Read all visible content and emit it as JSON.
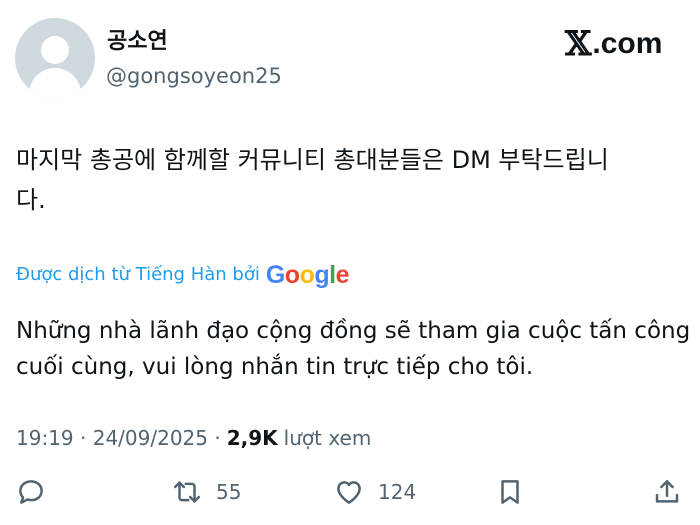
{
  "author": {
    "display_name": "공소연",
    "handle": "@gongsoyeon25"
  },
  "brand": {
    "logo_x": "𝕏",
    "logo_text": ".com"
  },
  "tweet": {
    "text": "마지막 총공에 함께할 커뮤니티 총대분들은 DM 부탁드립니\n다."
  },
  "translation": {
    "label": "Được dịch từ Tiếng Hàn bởi",
    "provider_letters": [
      "G",
      "o",
      "o",
      "g",
      "l",
      "e"
    ],
    "text": "Những nhà lãnh đạo cộng đồng sẽ tham gia cuộc tấn công\ncuối cùng, vui lòng nhắn tin trực tiếp cho tôi."
  },
  "meta": {
    "time": "19:19",
    "separator": "·",
    "date": "24/09/2025",
    "views_count": "2,9K",
    "views_label": "lượt xem"
  },
  "actions": {
    "reply": {
      "icon": "reply-icon",
      "count": ""
    },
    "repost": {
      "icon": "repost-icon",
      "count": "55"
    },
    "like": {
      "icon": "heart-icon",
      "count": "124"
    },
    "bookmark": {
      "icon": "bookmark-icon",
      "count": ""
    },
    "share": {
      "icon": "share-icon",
      "count": ""
    }
  },
  "colors": {
    "accent": "#1d9bf0",
    "muted": "#536471",
    "text": "#0f1419",
    "avatar_bg": "#cfd9de"
  }
}
